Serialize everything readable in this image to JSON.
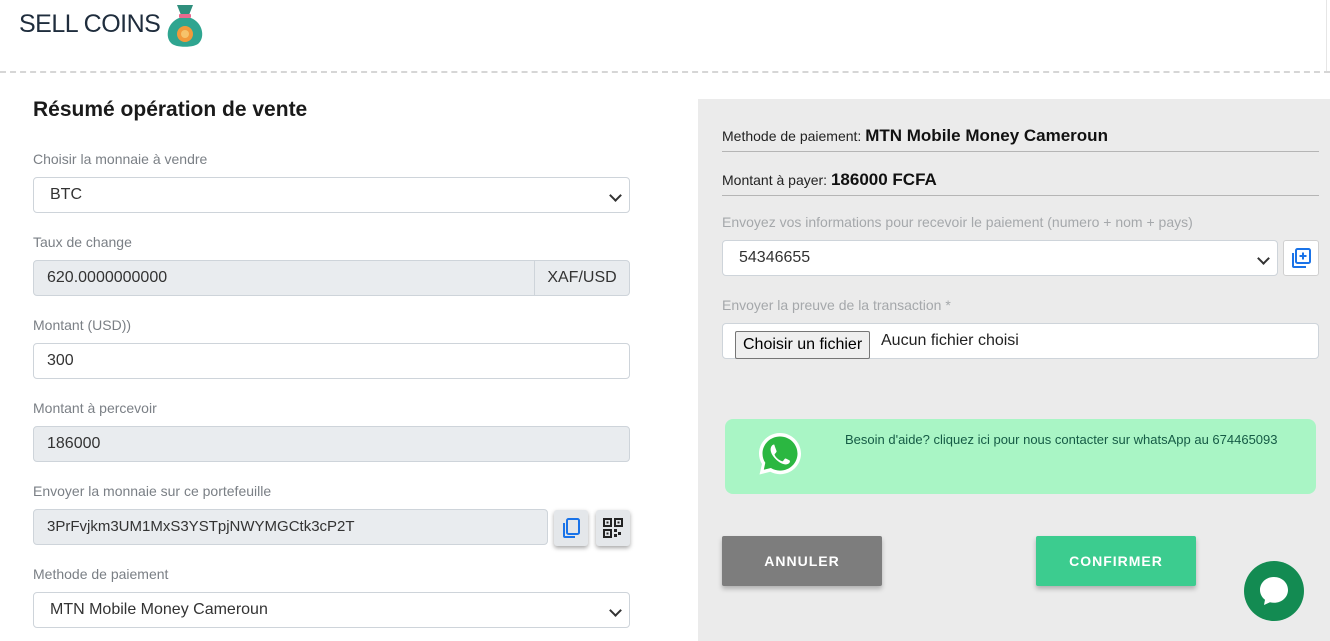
{
  "header": {
    "title": "SELL COINS"
  },
  "form": {
    "heading": "Résumé opération de vente",
    "currency": {
      "label": "Choisir la monnaie à vendre",
      "value": "BTC"
    },
    "rate": {
      "label": "Taux de change",
      "value": "620.0000000000",
      "unit": "XAF/USD"
    },
    "amount": {
      "label": "Montant (USD))",
      "value": "300"
    },
    "receive": {
      "label": "Montant à percevoir",
      "value": "186000"
    },
    "wallet": {
      "label": "Envoyer la monnaie sur ce portefeuille",
      "value": "3PrFvjkm3UM1MxS3YSTpjNWYMGCtk3cP2T"
    },
    "payment": {
      "label": "Methode de paiement",
      "value": "MTN Mobile Money Cameroun"
    }
  },
  "summary": {
    "method_label": "Methode de paiement:",
    "method_value": "MTN Mobile Money Cameroun",
    "amount_label": "Montant à payer:",
    "amount_value": "186000 FCFA",
    "info_label": "Envoyez vos informations pour recevoir le paiement (numero + nom + pays)",
    "info_value": "54346655",
    "proof_label": "Envoyer la preuve de la transaction *",
    "file_button": "Choisir un fichier",
    "file_status": "Aucun fichier choisi"
  },
  "help": {
    "text": "Besoin d'aide? cliquez ici pour nous contacter sur whatsApp au 674465093"
  },
  "actions": {
    "cancel": "ANNULER",
    "confirm": "CONFIRMER"
  },
  "colors": {
    "whatsapp": "#2bb741",
    "help_bg": "#a9f5c5",
    "cancel": "#7d7d7d",
    "confirm": "#3ccc8f",
    "chat": "#138b52",
    "panel": "#ebebeb"
  },
  "icons": [
    "money-bag-icon",
    "copy-icon",
    "qr-code-icon",
    "add-box-icon",
    "whatsapp-icon",
    "chat-bubble-icon",
    "chevron-down-icon"
  ]
}
